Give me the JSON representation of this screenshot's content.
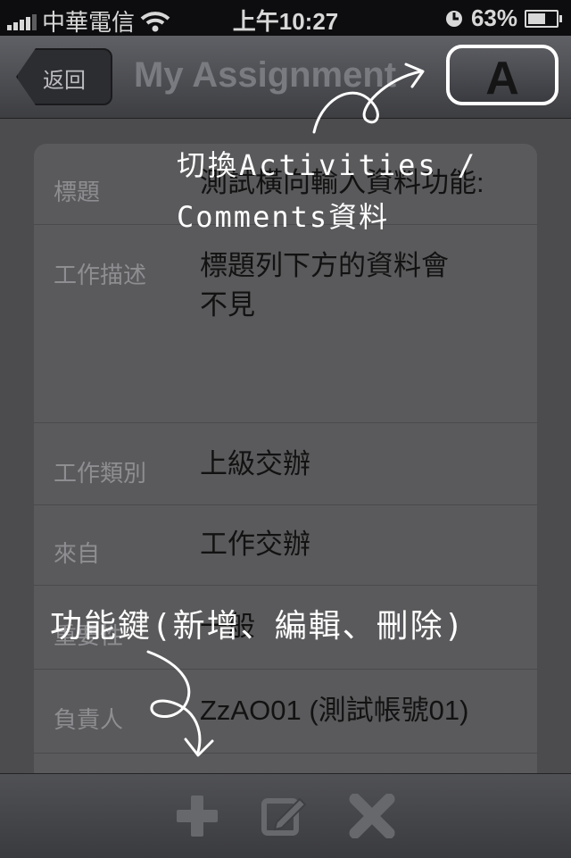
{
  "status_bar": {
    "carrier": "中華電信",
    "time": "上午10:27",
    "battery": "63%",
    "battery_level": 0.63
  },
  "nav": {
    "back_label": "返回",
    "title": "My Assignment",
    "toggle_label": "A"
  },
  "fields": [
    {
      "label": "標題",
      "value": "測試橫向輸入資料功能:"
    },
    {
      "label": "工作描述",
      "value_lines": [
        "標題列下方的資料會",
        "不見"
      ]
    },
    {
      "label": "工作類別",
      "value": "上級交辦"
    },
    {
      "label": "來自",
      "value": "工作交辦"
    },
    {
      "label": "重要性",
      "value": "一般"
    },
    {
      "label": "負責人",
      "value": "ZzAO01 (測試帳號01)"
    }
  ],
  "toolbar": {
    "icons": [
      "add-icon",
      "edit-icon",
      "delete-icon"
    ]
  },
  "annotations": {
    "top_line1": "切換Activities /",
    "top_line2": "Comments資料",
    "bottom": "功能鍵(新增、編輯、刪除)"
  }
}
